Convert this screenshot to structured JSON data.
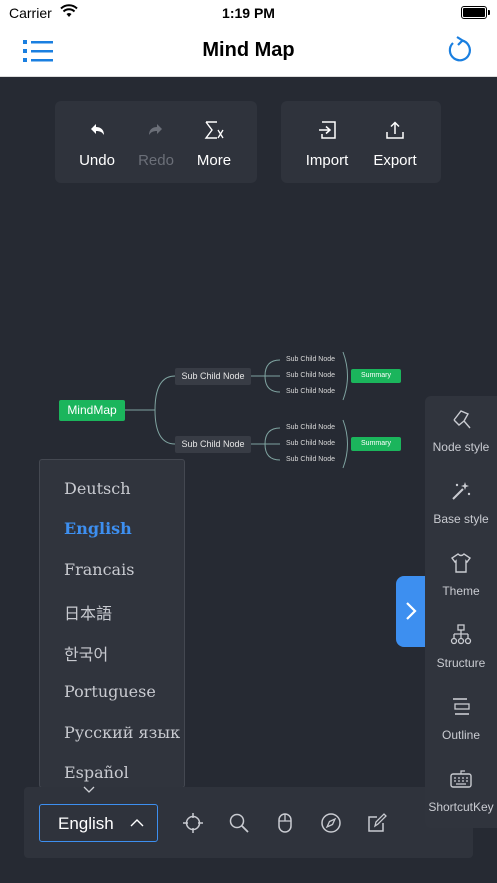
{
  "status_bar": {
    "carrier": "Carrier",
    "time": "1:19 PM"
  },
  "nav": {
    "title": "Mind Map",
    "menu_icon": "list-icon",
    "refresh_icon": "refresh-icon"
  },
  "toolbar": {
    "undo": "Undo",
    "redo": "Redo",
    "more": "More",
    "import": "Import",
    "export": "Export"
  },
  "mindmap": {
    "root": "MindMap",
    "branches": [
      {
        "label": "Sub Child Node",
        "children": [
          "Sub Child Node",
          "Sub Child Node",
          "Sub Child Node"
        ],
        "summary": "Summary"
      },
      {
        "label": "Sub Child Node",
        "children": [
          "Sub Child Node",
          "Sub Child Node",
          "Sub Child Node"
        ],
        "summary": "Summary"
      }
    ]
  },
  "language": {
    "selected": "English",
    "options": [
      "Deutsch",
      "English",
      "Francais",
      "日本語",
      "한국어",
      "Portuguese",
      "Русский язык",
      "Español"
    ]
  },
  "side_panel": {
    "items": [
      "Node style",
      "Base style",
      "Theme",
      "Structure",
      "Outline",
      "ShortcutKey"
    ]
  },
  "colors": {
    "accent": "#3d8ff0",
    "node_green": "#1bb55c",
    "canvas": "#262a33",
    "panel": "#30343d"
  }
}
